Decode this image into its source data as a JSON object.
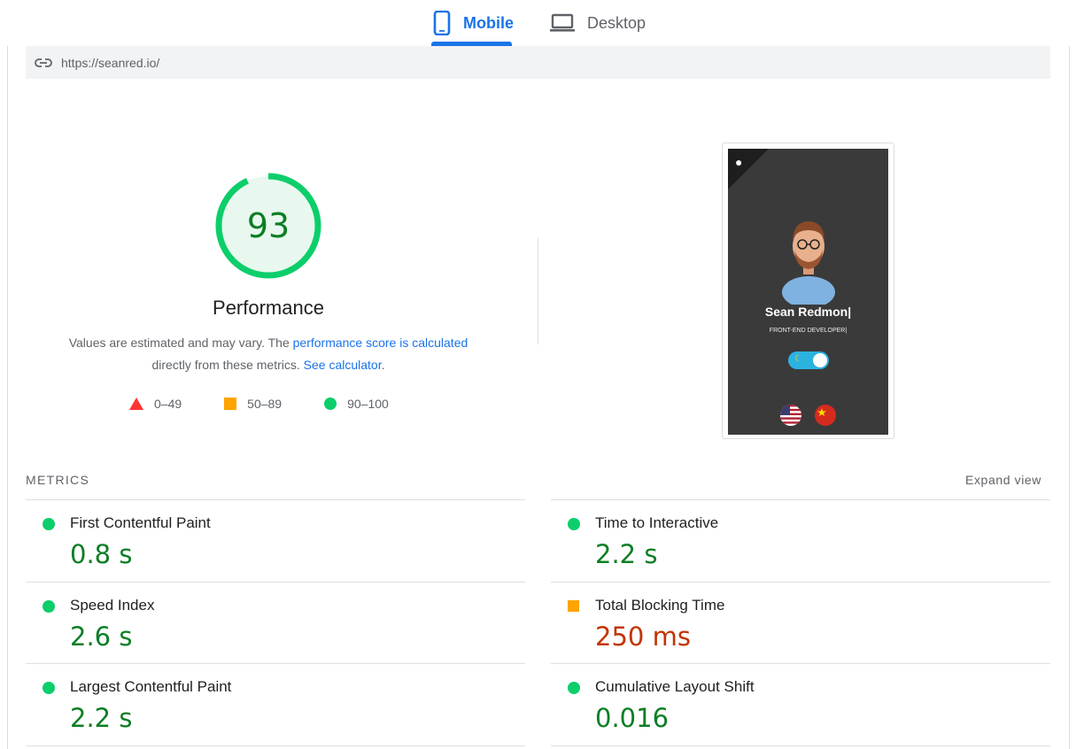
{
  "tabs": [
    {
      "label": "Mobile",
      "icon": "smartphone-icon",
      "active": true
    },
    {
      "label": "Desktop",
      "icon": "laptop-icon",
      "active": false
    }
  ],
  "url": "https://seanred.io/",
  "performance": {
    "score": "93",
    "score_value": 93,
    "title": "Performance",
    "desc_prefix": "Values are estimated and may vary. The ",
    "desc_link1": "performance score is calculated",
    "desc_middle": " directly from these metrics. ",
    "desc_link2": "See calculator",
    "desc_suffix": ".",
    "color": "#0cce6b"
  },
  "legend": [
    {
      "label": "0–49",
      "shape": "triangle",
      "color": "#ff3333"
    },
    {
      "label": "50–89",
      "shape": "square",
      "color": "#ffa400"
    },
    {
      "label": "90–100",
      "shape": "circle",
      "color": "#0cce6b"
    }
  ],
  "screenshot": {
    "name": "Sean Redmon|",
    "role": "FRONT-END DEVELOPER|"
  },
  "metrics_section": {
    "label": "METRICS",
    "expand": "Expand view"
  },
  "metrics": [
    {
      "name": "First Contentful Paint",
      "value": "0.8 s",
      "status": "pass"
    },
    {
      "name": "Time to Interactive",
      "value": "2.2 s",
      "status": "pass"
    },
    {
      "name": "Speed Index",
      "value": "2.6 s",
      "status": "pass"
    },
    {
      "name": "Total Blocking Time",
      "value": "250 ms",
      "status": "average"
    },
    {
      "name": "Largest Contentful Paint",
      "value": "2.2 s",
      "status": "pass"
    },
    {
      "name": "Cumulative Layout Shift",
      "value": "0.016",
      "status": "pass"
    }
  ],
  "colors": {
    "accent": "#1a73e8",
    "pass": "#0cce6b",
    "pass_text": "#0c7e24",
    "average": "#ffa400",
    "average_text": "#c33300",
    "fail": "#ff3333"
  }
}
